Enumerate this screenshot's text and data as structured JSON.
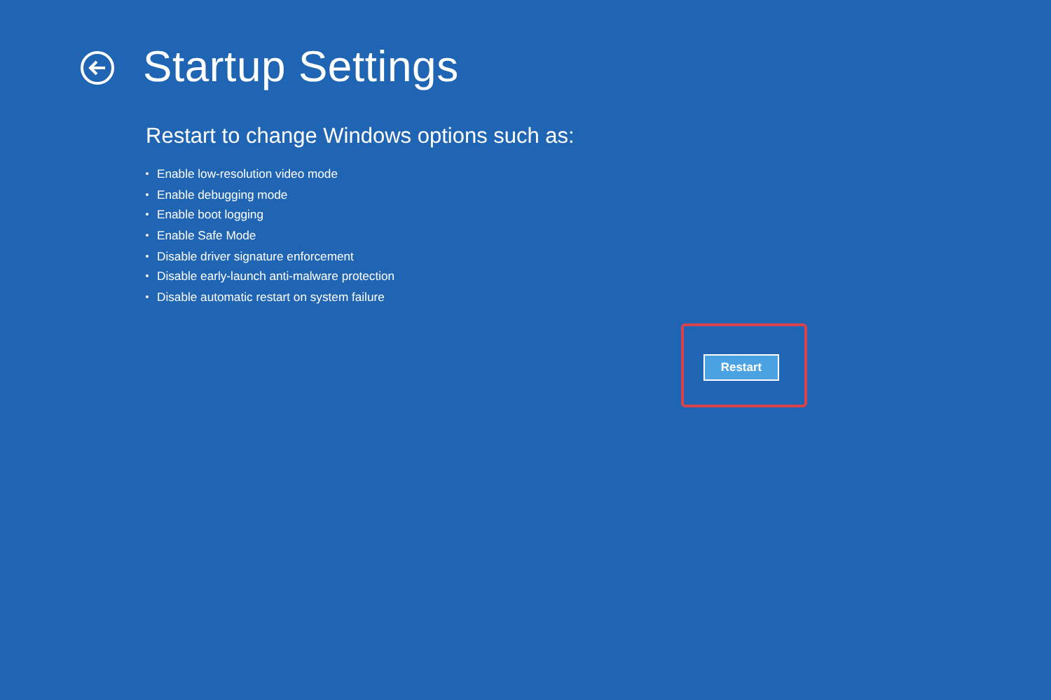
{
  "title": "Startup Settings",
  "subtitle": "Restart to change Windows options such as:",
  "options": [
    {
      "label": "Enable low-resolution video mode"
    },
    {
      "label": "Enable debugging mode"
    },
    {
      "label": "Enable boot logging"
    },
    {
      "label": "Enable Safe Mode"
    },
    {
      "label": "Disable driver signature enforcement"
    },
    {
      "label": "Disable early-launch anti-malware protection"
    },
    {
      "label": "Disable automatic restart on system failure"
    }
  ],
  "restart_button": {
    "label": "Restart",
    "highlighted": true
  }
}
